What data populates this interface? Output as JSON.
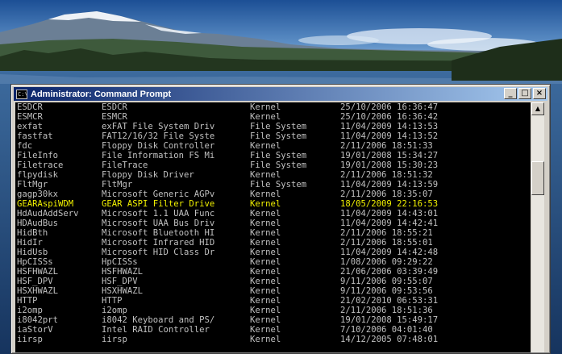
{
  "window": {
    "title": "Administrator: Command Prompt",
    "icon_text": "C:\\",
    "buttons": {
      "minimize": "_",
      "maximize": "□",
      "close": "×"
    }
  },
  "scrollbar": {
    "up_arrow": "▲"
  },
  "rows": [
    {
      "name": "ESDCR",
      "display": "ESDCR",
      "type": "Kernel",
      "date": "25/10/2006 16:36:47"
    },
    {
      "name": "ESMCR",
      "display": "ESMCR",
      "type": "Kernel",
      "date": "25/10/2006 16:36:42"
    },
    {
      "name": "exfat",
      "display": "exFAT File System Driv",
      "type": "File System",
      "date": "11/04/2009 14:13:53"
    },
    {
      "name": "fastfat",
      "display": "FAT12/16/32 File Syste",
      "type": "File System",
      "date": "11/04/2009 14:13:52"
    },
    {
      "name": "fdc",
      "display": "Floppy Disk Controller",
      "type": "Kernel",
      "date": "2/11/2006 18:51:33"
    },
    {
      "name": "FileInfo",
      "display": "File Information FS Mi",
      "type": "File System",
      "date": "19/01/2008 15:34:27"
    },
    {
      "name": "Filetrace",
      "display": "FileTrace",
      "type": "File System",
      "date": "19/01/2008 15:30:23"
    },
    {
      "name": "flpydisk",
      "display": "Floppy Disk Driver",
      "type": "Kernel",
      "date": "2/11/2006 18:51:32"
    },
    {
      "name": "FltMgr",
      "display": "FltMgr",
      "type": "File System",
      "date": "11/04/2009 14:13:59"
    },
    {
      "name": "gagp30kx",
      "display": "Microsoft Generic AGPv",
      "type": "Kernel",
      "date": "2/11/2006 18:35:07"
    },
    {
      "name": "GEARAspiWDM",
      "display": "GEAR ASPI Filter Drive",
      "type": "Kernel",
      "date": "18/05/2009 22:16:53",
      "highlight": true
    },
    {
      "name": "HdAudAddServ",
      "display": "Microsoft 1.1 UAA Func",
      "type": "Kernel",
      "date": "11/04/2009 14:43:01"
    },
    {
      "name": "HDAudBus",
      "display": "Microsoft UAA Bus Driv",
      "type": "Kernel",
      "date": "11/04/2009 14:42:41"
    },
    {
      "name": "HidBth",
      "display": "Microsoft Bluetooth HI",
      "type": "Kernel",
      "date": "2/11/2006 18:55:21"
    },
    {
      "name": "HidIr",
      "display": "Microsoft Infrared HID",
      "type": "Kernel",
      "date": "2/11/2006 18:55:01"
    },
    {
      "name": "HidUsb",
      "display": "Microsoft HID Class Dr",
      "type": "Kernel",
      "date": "11/04/2009 14:42:48"
    },
    {
      "name": "HpCISSs",
      "display": "HpCISSs",
      "type": "Kernel",
      "date": "1/08/2006 09:29:22"
    },
    {
      "name": "HSFHWAZL",
      "display": "HSFHWAZL",
      "type": "Kernel",
      "date": "21/06/2006 03:39:49"
    },
    {
      "name": "HSF_DPV",
      "display": "HSF_DPV",
      "type": "Kernel",
      "date": "9/11/2006 09:55:07"
    },
    {
      "name": "HSXHWAZL",
      "display": "HSXHWAZL",
      "type": "Kernel",
      "date": "9/11/2006 09:53:56"
    },
    {
      "name": "HTTP",
      "display": "HTTP",
      "type": "Kernel",
      "date": "21/02/2010 06:53:31"
    },
    {
      "name": "i2omp",
      "display": "i2omp",
      "type": "Kernel",
      "date": "2/11/2006 18:51:36"
    },
    {
      "name": "i8042prt",
      "display": "i8042 Keyboard and PS/",
      "type": "Kernel",
      "date": "19/01/2008 15:49:17"
    },
    {
      "name": "iaStorV",
      "display": "Intel RAID Controller",
      "type": "Kernel",
      "date": "7/10/2006 04:01:40"
    },
    {
      "name": "iirsp",
      "display": "iirsp",
      "type": "Kernel",
      "date": "14/12/2005 07:48:01"
    }
  ]
}
